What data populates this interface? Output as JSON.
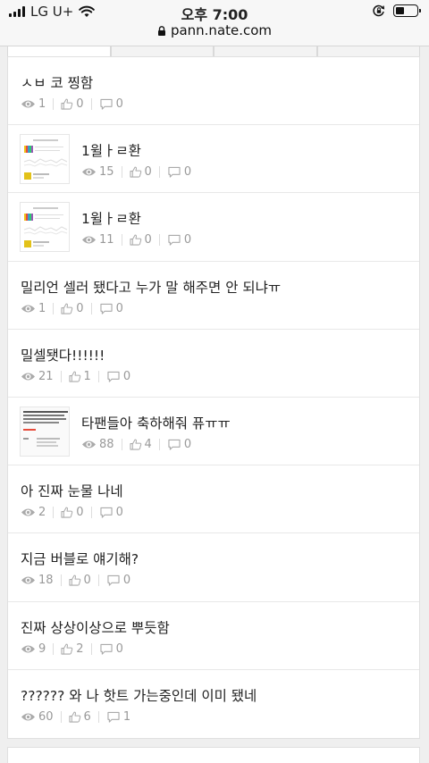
{
  "statusbar": {
    "carrier": "LG U+",
    "time": "오후 7:00",
    "url": "pann.nate.com"
  },
  "posts": [
    {
      "title": "ㅅㅂ 코 찡함",
      "views": "1",
      "likes": "0",
      "comments": "0",
      "thumb": false
    },
    {
      "title": "1윌ㅏㄹ환",
      "views": "15",
      "likes": "0",
      "comments": "0",
      "thumb": true
    },
    {
      "title": "1윌ㅏㄹ환",
      "views": "11",
      "likes": "0",
      "comments": "0",
      "thumb": true
    },
    {
      "title": "밀리언 셀러 됐다고 누가 말 해주면 안 되냐ㅠ",
      "views": "1",
      "likes": "0",
      "comments": "0",
      "thumb": false
    },
    {
      "title": "밀셀됏다!!!!!!",
      "views": "21",
      "likes": "1",
      "comments": "0",
      "thumb": false
    },
    {
      "title": "타팬들아 축하해줘 퓨ㅠㅠ",
      "views": "88",
      "likes": "4",
      "comments": "0",
      "thumb": true
    },
    {
      "title": "아 진짜 눈물 나네",
      "views": "2",
      "likes": "0",
      "comments": "0",
      "thumb": false
    },
    {
      "title": "지금 버블로 얘기해?",
      "views": "18",
      "likes": "0",
      "comments": "0",
      "thumb": false
    },
    {
      "title": "진짜 상상이상으로 뿌듯함",
      "views": "9",
      "likes": "2",
      "comments": "0",
      "thumb": false
    },
    {
      "title": "?????? 와 나 핫트 가는중인데 이미 됐네",
      "views": "60",
      "likes": "6",
      "comments": "1",
      "thumb": false
    }
  ]
}
